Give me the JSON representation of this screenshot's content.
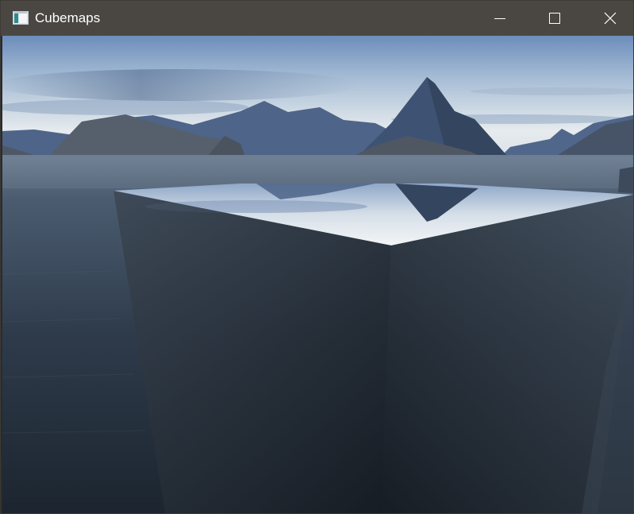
{
  "window": {
    "title": "Cubemaps",
    "icon": "app-window-icon",
    "controls": {
      "minimize_icon": "minimize-icon",
      "maximize_icon": "maximize-icon",
      "close_icon": "close-icon"
    }
  },
  "scene": {
    "description_icon": "rendered-3d-viewport",
    "colors": {
      "titlebar": "#4a4743",
      "sky_top": "#6f8fbd",
      "sky_bottom": "#e9ecee",
      "water": "#2c3a4a",
      "mountain": "#4b6185",
      "cube_front": "#222a33"
    }
  }
}
